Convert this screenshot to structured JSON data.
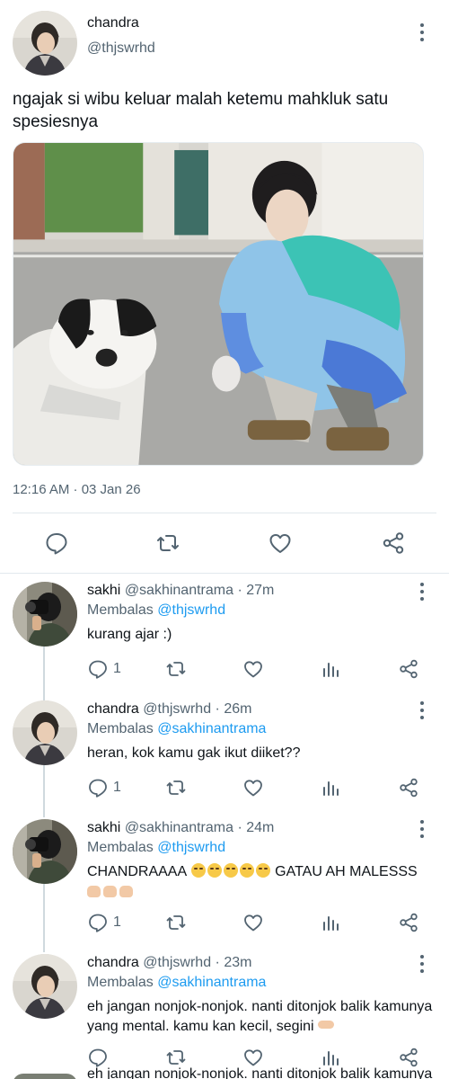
{
  "tweet": {
    "name": "chandra",
    "handle": "@thjswrhd",
    "text": "ngajak si wibu keluar malah ketemu mahkluk satu spesiesnya",
    "timestamp": "12:16 AM · 03 Jan 26"
  },
  "icons": {
    "reply": "reply-icon",
    "retweet": "retweet-icon",
    "like": "heart-icon",
    "share": "share-icon",
    "views": "views-icon",
    "more": "more-vertical-icon"
  },
  "colors": {
    "mention": "#1d9bf0",
    "secondary_text": "#536471",
    "icon": "#536471",
    "divider": "#e1e8ed"
  },
  "replies": [
    {
      "name": "sakhi",
      "handle": "@sakhinantrama",
      "time": "27m",
      "replying_label": "Membalas",
      "replying_to": "@thjswrhd",
      "text": "kurang ajar :)",
      "reply_count": "1"
    },
    {
      "name": "chandra",
      "handle": "@thjswrhd",
      "time": "26m",
      "replying_label": "Membalas",
      "replying_to": "@sakhinantrama",
      "text": "heran, kok kamu gak ikut diiket??",
      "reply_count": "1"
    },
    {
      "name": "sakhi",
      "handle": "@sakhinantrama",
      "time": "24m",
      "replying_label": "Membalas",
      "replying_to": "@thjswrhd",
      "text_part1": "CHANDRAAAA",
      "text_part2": "GATAU AH MALESSS",
      "reply_count": "1"
    },
    {
      "name": "chandra",
      "handle": "@thjswrhd",
      "time": "23m",
      "replying_label": "Membalas",
      "replying_to": "@sakhinantrama",
      "text": "eh jangan nonjok-nonjok. nanti ditonjok balik kamunya yang mental. kamu kan kecil, segini"
    }
  ],
  "cutoff_text": "eh jangan nonjok-nonjok. nanti ditonjok balik kamunya"
}
